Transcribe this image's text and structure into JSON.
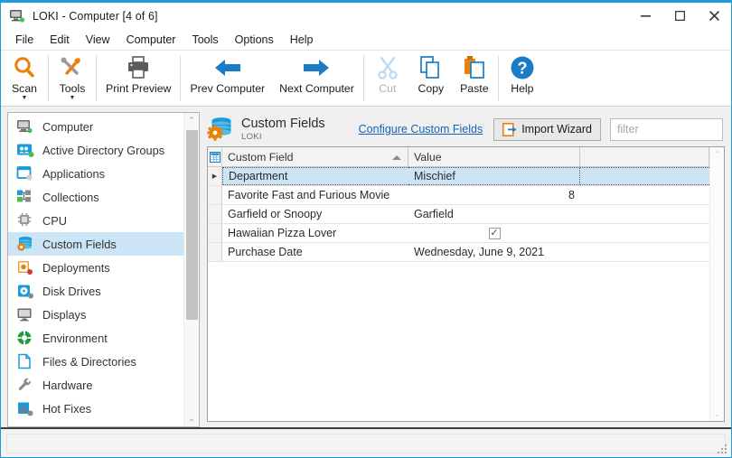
{
  "window": {
    "title": "LOKI - Computer [4 of 6]",
    "icon": "computer-icon",
    "accent_color": "#1e9ad6",
    "minimize_label": "–",
    "maximize_label": "❐",
    "close_label": "✕"
  },
  "menu": {
    "items": [
      {
        "label": "File"
      },
      {
        "label": "Edit"
      },
      {
        "label": "View"
      },
      {
        "label": "Computer"
      },
      {
        "label": "Tools"
      },
      {
        "label": "Options"
      },
      {
        "label": "Help"
      }
    ]
  },
  "toolbar": {
    "buttons": [
      {
        "label": "Scan",
        "icon": "magnifier-icon",
        "dropdown": true,
        "disabled": false
      },
      {
        "label": "Tools",
        "icon": "wrench-screwdriver-icon",
        "dropdown": true,
        "disabled": false
      },
      {
        "label": "Print Preview",
        "icon": "printer-icon",
        "dropdown": false,
        "disabled": false
      },
      {
        "label": "Prev Computer",
        "icon": "arrow-left-icon",
        "dropdown": false,
        "disabled": false
      },
      {
        "label": "Next Computer",
        "icon": "arrow-right-icon",
        "dropdown": false,
        "disabled": false
      },
      {
        "label": "Cut",
        "icon": "scissors-icon",
        "dropdown": false,
        "disabled": true
      },
      {
        "label": "Copy",
        "icon": "copy-pages-icon",
        "dropdown": false,
        "disabled": false
      },
      {
        "label": "Paste",
        "icon": "clipboard-paste-icon",
        "dropdown": false,
        "disabled": false
      },
      {
        "label": "Help",
        "icon": "question-circle-icon",
        "dropdown": false,
        "disabled": false
      }
    ],
    "caret": "▼"
  },
  "sidebar": {
    "selected": "Custom Fields",
    "scroll_up": "⌃",
    "scroll_down": "⌄",
    "items": [
      {
        "label": "Computer",
        "icon": "computer-icon"
      },
      {
        "label": "Active Directory Groups",
        "icon": "ad-groups-icon"
      },
      {
        "label": "Applications",
        "icon": "applications-icon"
      },
      {
        "label": "Collections",
        "icon": "collections-icon"
      },
      {
        "label": "CPU",
        "icon": "cpu-icon"
      },
      {
        "label": "Custom Fields",
        "icon": "custom-fields-icon"
      },
      {
        "label": "Deployments",
        "icon": "deployments-icon"
      },
      {
        "label": "Disk Drives",
        "icon": "disk-drives-icon"
      },
      {
        "label": "Displays",
        "icon": "displays-icon"
      },
      {
        "label": "Environment",
        "icon": "environment-icon"
      },
      {
        "label": "Files & Directories",
        "icon": "file-icon"
      },
      {
        "label": "Hardware",
        "icon": "wrench-icon"
      },
      {
        "label": "Hot Fixes",
        "icon": "hot-fixes-icon"
      }
    ]
  },
  "panel": {
    "icon": "database-gear-icon",
    "title": "Custom Fields",
    "subtitle": "LOKI",
    "configure_link": "Configure Custom Fields",
    "import_button": "Import Wizard",
    "import_icon": "import-wizard-icon",
    "filter_placeholder": "filter",
    "filter_value": ""
  },
  "grid": {
    "corner_icon": "grid-corner-icon",
    "current_row_marker": "▶",
    "sort_column": "Custom Field",
    "sort_direction": "ascending",
    "columns": [
      {
        "label": "Custom Field"
      },
      {
        "label": "Value"
      },
      {
        "label": ""
      }
    ],
    "rows": [
      {
        "field": "Department",
        "value": "Mischief",
        "align": "left",
        "selected": true,
        "checkbox": false
      },
      {
        "field": "Favorite Fast and Furious Movie",
        "value": "8",
        "align": "right",
        "selected": false,
        "checkbox": false
      },
      {
        "field": "Garfield or Snoopy",
        "value": "Garfield",
        "align": "left",
        "selected": false,
        "checkbox": false
      },
      {
        "field": "Hawaiian Pizza Lover",
        "value": "",
        "align": "center",
        "selected": false,
        "checkbox": true,
        "checked": true,
        "check_glyph": "✓"
      },
      {
        "field": "Purchase Date",
        "value": "Wednesday, June 9, 2021",
        "align": "left",
        "selected": false,
        "checkbox": false
      }
    ],
    "scroll_up": "⌃",
    "scroll_down": "⌄"
  },
  "statusbar": {
    "text": ""
  }
}
